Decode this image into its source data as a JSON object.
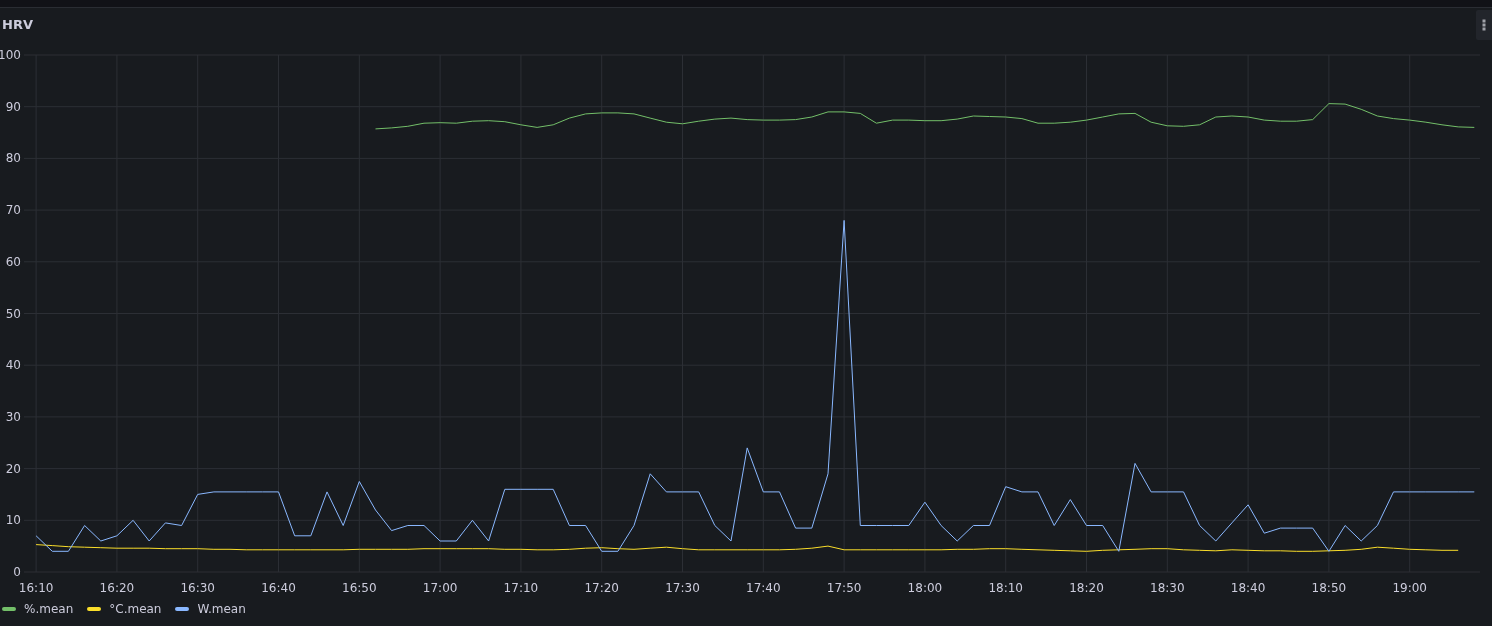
{
  "panel": {
    "title": "HRV"
  },
  "chart_data": {
    "type": "line",
    "grid": true,
    "xlim": [
      968.5,
      1148.7
    ],
    "ylim": [
      0,
      100
    ],
    "yticks": [
      0,
      10,
      20,
      30,
      40,
      50,
      60,
      70,
      80,
      90,
      100
    ],
    "xticks": [
      {
        "value": 970,
        "label": "16:10"
      },
      {
        "value": 980,
        "label": "16:20"
      },
      {
        "value": 990,
        "label": "16:30"
      },
      {
        "value": 1000,
        "label": "16:40"
      },
      {
        "value": 1010,
        "label": "16:50"
      },
      {
        "value": 1020,
        "label": "17:00"
      },
      {
        "value": 1030,
        "label": "17:10"
      },
      {
        "value": 1040,
        "label": "17:20"
      },
      {
        "value": 1050,
        "label": "17:30"
      },
      {
        "value": 1060,
        "label": "17:40"
      },
      {
        "value": 1070,
        "label": "17:50"
      },
      {
        "value": 1080,
        "label": "18:00"
      },
      {
        "value": 1090,
        "label": "18:10"
      },
      {
        "value": 1100,
        "label": "18:20"
      },
      {
        "value": 1110,
        "label": "18:30"
      },
      {
        "value": 1120,
        "label": "18:40"
      },
      {
        "value": 1130,
        "label": "18:50"
      },
      {
        "value": 1140,
        "label": "19:00"
      }
    ],
    "x": [
      970,
      972,
      974,
      976,
      978,
      980,
      982,
      984,
      986,
      988,
      990,
      992,
      994,
      996,
      998,
      1000,
      1002,
      1004,
      1006,
      1008,
      1010,
      1012,
      1014,
      1016,
      1018,
      1020,
      1022,
      1024,
      1026,
      1028,
      1030,
      1032,
      1034,
      1036,
      1038,
      1040,
      1042,
      1044,
      1046,
      1048,
      1050,
      1052,
      1054,
      1056,
      1058,
      1060,
      1062,
      1064,
      1066,
      1068,
      1070,
      1072,
      1074,
      1076,
      1078,
      1080,
      1082,
      1084,
      1086,
      1088,
      1090,
      1092,
      1094,
      1096,
      1098,
      1100,
      1102,
      1104,
      1106,
      1108,
      1110,
      1112,
      1114,
      1116,
      1118,
      1120,
      1122,
      1124,
      1126,
      1128,
      1130,
      1132,
      1134,
      1136,
      1138,
      1140,
      1142,
      1144,
      1146,
      1148
    ],
    "series": [
      {
        "name": "%.mean",
        "color": "#73bf69",
        "values": [
          null,
          null,
          null,
          null,
          null,
          null,
          null,
          null,
          null,
          null,
          null,
          null,
          null,
          null,
          null,
          null,
          null,
          null,
          null,
          null,
          null,
          85.7,
          85.9,
          86.2,
          86.8,
          86.9,
          86.8,
          87.2,
          87.3,
          87.1,
          86.5,
          86,
          86.5,
          87.8,
          88.6,
          88.8,
          88.8,
          88.6,
          87.8,
          87,
          86.7,
          87.2,
          87.6,
          87.8,
          87.5,
          87.4,
          87.4,
          87.5,
          88,
          89,
          89,
          88.7,
          86.8,
          87.4,
          87.4,
          87.3,
          87.3,
          87.6,
          88.2,
          88.1,
          88,
          87.7,
          86.8,
          86.8,
          87,
          87.4,
          88,
          88.6,
          88.7,
          87,
          86.3,
          86.2,
          86.5,
          88,
          88.2,
          88,
          87.4,
          87.2,
          87.2,
          87.5,
          90.6,
          90.5,
          89.5,
          88.2,
          87.7,
          87.4,
          87,
          86.5,
          86.1,
          86
        ]
      },
      {
        "name": "°C.mean",
        "color": "#fade2a",
        "values": [
          5.3,
          5.1,
          4.9,
          4.8,
          4.7,
          4.6,
          4.6,
          4.6,
          4.5,
          4.5,
          4.5,
          4.4,
          4.4,
          4.3,
          4.3,
          4.3,
          4.3,
          4.3,
          4.3,
          4.3,
          4.4,
          4.4,
          4.4,
          4.4,
          4.5,
          4.5,
          4.5,
          4.5,
          4.5,
          4.4,
          4.4,
          4.3,
          4.3,
          4.4,
          4.6,
          4.7,
          4.5,
          4.4,
          4.6,
          4.8,
          4.5,
          4.3,
          4.3,
          4.3,
          4.3,
          4.3,
          4.3,
          4.4,
          4.6,
          5,
          4.3,
          4.3,
          4.3,
          4.3,
          4.3,
          4.3,
          4.3,
          4.4,
          4.4,
          4.5,
          4.5,
          4.4,
          4.3,
          4.2,
          4.1,
          4,
          4.2,
          4.3,
          4.4,
          4.5,
          4.5,
          4.3,
          4.2,
          4.1,
          4.3,
          4.2,
          4.1,
          4.1,
          4,
          4,
          4.1,
          4.2,
          4.4,
          4.8,
          4.6,
          4.4,
          4.3,
          4.2,
          4.2,
          null
        ]
      },
      {
        "name": "W.mean",
        "color": "#8ab8ff",
        "values": [
          7,
          4,
          4,
          9,
          6,
          7,
          10,
          6,
          9.5,
          9,
          15,
          15.5,
          15.5,
          15.5,
          15.5,
          15.5,
          7,
          7,
          15.5,
          9,
          17.5,
          12,
          8,
          9,
          9,
          6,
          6,
          10,
          6,
          16,
          16,
          16,
          16,
          9,
          9,
          4,
          4,
          9,
          19,
          15.5,
          15.5,
          15.5,
          9,
          6,
          24,
          15.5,
          15.5,
          8.5,
          8.5,
          19,
          68,
          9,
          9,
          9,
          9,
          13.5,
          9,
          6,
          9,
          9,
          16.5,
          15.5,
          15.5,
          9,
          14,
          9,
          9,
          4,
          21,
          15.5,
          15.5,
          15.5,
          9,
          6,
          9.5,
          13,
          7.5,
          8.5,
          8.5,
          8.5,
          4,
          9,
          6,
          9,
          15.5,
          15.5,
          15.5,
          15.5,
          15.5,
          15.5
        ]
      }
    ]
  }
}
